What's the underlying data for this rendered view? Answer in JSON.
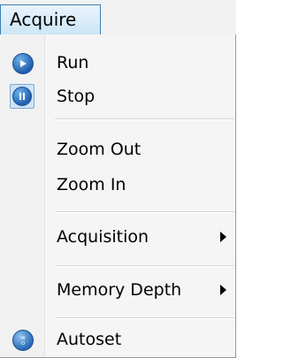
{
  "menu": {
    "title": "Acquire",
    "items": [
      {
        "label": "Run",
        "icon": "run-icon"
      },
      {
        "label": "Stop",
        "icon": "stop-icon"
      },
      {
        "label": "Zoom Out"
      },
      {
        "label": "Zoom In"
      },
      {
        "label": "Acquisition",
        "submenu": true
      },
      {
        "label": "Memory Depth",
        "submenu": true
      },
      {
        "label": "Autoset",
        "icon": "autoset-icon"
      }
    ]
  },
  "colors": {
    "menu_button_border": "#3c7fb1",
    "icon_blue": "#1f5fae"
  }
}
